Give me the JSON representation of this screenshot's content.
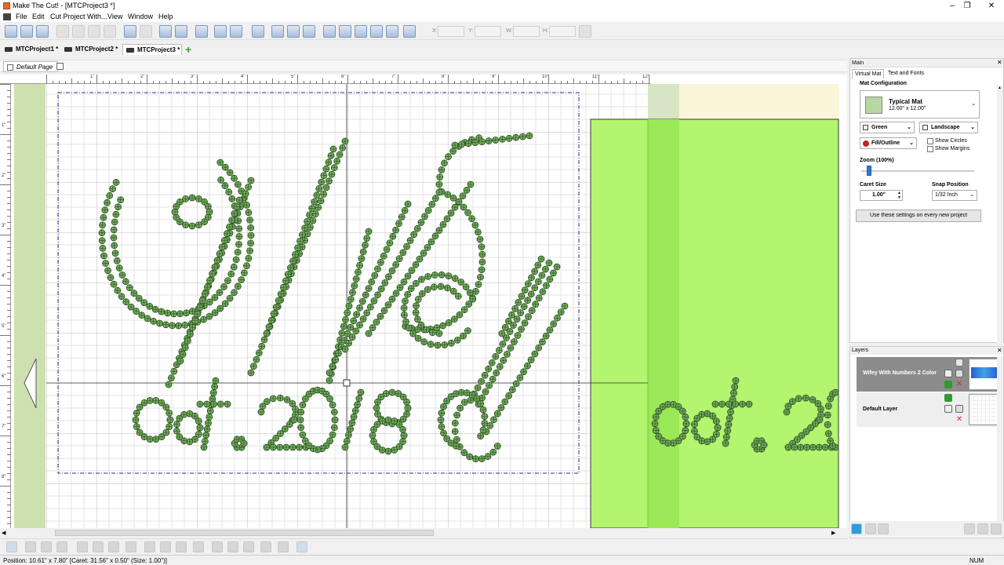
{
  "app": {
    "title": "Make The Cut! - [MTCProject3 *]",
    "window_controls": [
      "–",
      "❐",
      "✕"
    ]
  },
  "menu": [
    "File",
    "Edit",
    "Cut Project With...",
    "View",
    "Window",
    "Help"
  ],
  "toolbar": {
    "coord_labels": [
      "X:",
      "Y:",
      "W:",
      "H:"
    ]
  },
  "tabs": [
    {
      "label": "MTCProject1 *",
      "active": false
    },
    {
      "label": "MTCProject2 *",
      "active": false
    },
    {
      "label": "MTCProject3 *",
      "active": true
    }
  ],
  "page_tab": {
    "label": "Default Page"
  },
  "ruler": {
    "top_labels": [
      "1\"",
      "2\"",
      "3\"",
      "4\"",
      "5\"",
      "6\"",
      "7\"",
      "8\"",
      "9\"",
      "10\"",
      "11\"",
      "12\""
    ],
    "left_labels": [
      "1\"",
      "2\"",
      "3\"",
      "4\"",
      "5\"",
      "6\"",
      "7\"",
      "8\""
    ]
  },
  "canvas": {
    "main_text": "Wifey",
    "sub_text": "est. 2018",
    "sub_text_partial": "est. 20",
    "mat_color": "#b3f56e",
    "bead_color": "#6fae58"
  },
  "main_panel": {
    "header": "Main",
    "tabs": [
      "Virtual Mat",
      "Text and Fonts"
    ],
    "mat_configuration_label": "Mat Configuration",
    "mat_name": "Typical Mat",
    "mat_size": "12.00\" x 12.00\"",
    "mat_color": "Green",
    "orientation": "Landscape",
    "display_mode": "Fill/Outline",
    "show_circles": "Show Circles",
    "show_margins": "Show Margins",
    "zoom_label": "Zoom (100%)",
    "zoom_fraction": 0.05,
    "caret_size_label": "Caret Size",
    "caret_size_value": "1.00\"",
    "snap_position_label": "Snap Position",
    "snap_position_value": "1/32 Inch",
    "use_settings_button": "Use these settings on every new project"
  },
  "layers_panel": {
    "header": "Layers",
    "layers": [
      {
        "name": "Wifey With Numbers 2 Color",
        "selected": true
      },
      {
        "name": "Default Layer",
        "selected": false
      }
    ]
  },
  "status": {
    "text": "Position: 10.61\" x 7.80\" [Caret: 31.56\" x 0.50\" (Size: 1.00\")]",
    "num": "NUM"
  }
}
